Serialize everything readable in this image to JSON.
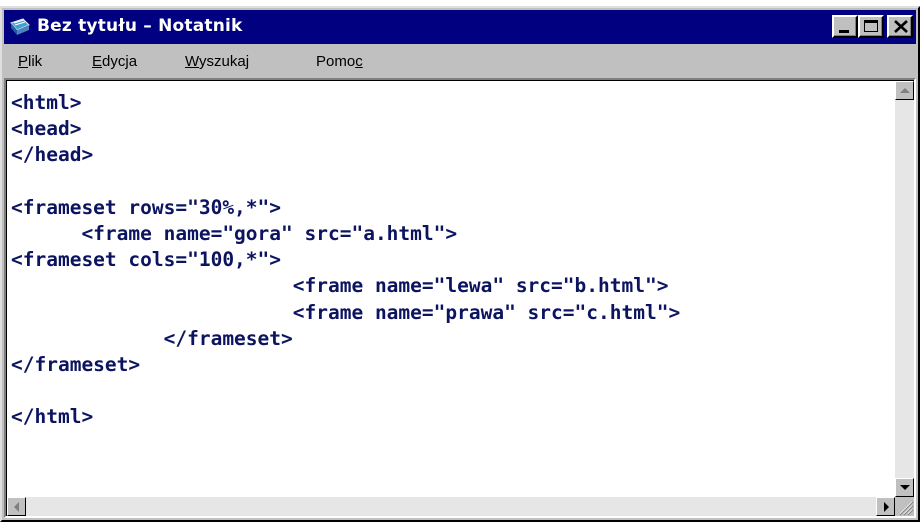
{
  "window": {
    "title": "Bez tytułu – Notatnik"
  },
  "menu": {
    "items": [
      {
        "pre": "",
        "key": "P",
        "post": "lik"
      },
      {
        "pre": "",
        "key": "E",
        "post": "dycja"
      },
      {
        "pre": "",
        "key": "W",
        "post": "yszukaj"
      },
      {
        "pre": "Pomo",
        "key": "c",
        "post": ""
      }
    ]
  },
  "editor": {
    "lines": [
      "<html>",
      "<head>",
      "</head>",
      "",
      "<frameset rows=\"30%,*\">",
      "      <frame name=\"gora\" src=\"a.html\">",
      "<frameset cols=\"100,*\">",
      "                        <frame name=\"lewa\" src=\"b.html\">",
      "                        <frame name=\"prawa\" src=\"c.html\">",
      "             </frameset>",
      "</frameset>",
      "",
      "</html>"
    ]
  },
  "icons": {
    "app": "notepad-icon",
    "minimize": "minimize-icon",
    "maximize": "maximize-icon",
    "close": "close-icon",
    "scroll_up": "scroll-up-arrow-icon",
    "scroll_down": "scroll-down-arrow-icon",
    "scroll_left": "scroll-left-arrow-icon",
    "scroll_right": "scroll-right-arrow-icon",
    "grip": "size-grip-icon"
  },
  "colors": {
    "titlebar": "#000080",
    "chrome": "#c0c0c0",
    "text": "#0c1460"
  }
}
